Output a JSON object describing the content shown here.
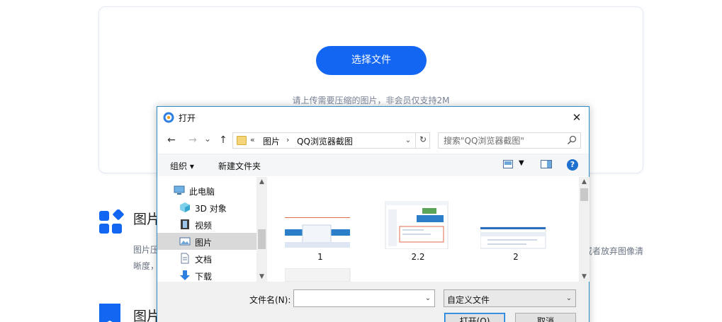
{
  "page": {
    "select_file_label": "选择文件",
    "upload_hint": "请上传需要压缩的图片，非会员仅支持2M",
    "feature1": {
      "title": "图片",
      "desc_line1": "图片压",
      "desc_line2": "晰度，",
      "desc_right": "或者放弃图像清"
    },
    "feature2": {
      "title": "图片"
    }
  },
  "dialog": {
    "title": "打开",
    "close_label": "✕",
    "nav": {
      "back": "←",
      "forward": "→",
      "recent": "⌄",
      "up": "↑"
    },
    "address": {
      "chevron": "«",
      "segments": [
        "图片",
        "QQ浏览器截图"
      ],
      "separator": "›"
    },
    "search_placeholder": "搜索\"QQ浏览器截图\"",
    "toolbar": {
      "organize": "组织 ▾",
      "new_folder": "新建文件夹",
      "help": "?"
    },
    "nav_pane": {
      "items": [
        {
          "label": "此电脑",
          "icon": "computer-icon"
        },
        {
          "label": "3D 对象",
          "icon": "3d-objects-icon"
        },
        {
          "label": "视频",
          "icon": "video-icon"
        },
        {
          "label": "图片",
          "icon": "pictures-icon",
          "selected": true
        },
        {
          "label": "文档",
          "icon": "documents-icon"
        },
        {
          "label": "下载",
          "icon": "downloads-icon"
        }
      ]
    },
    "files": [
      {
        "name": "1"
      },
      {
        "name": "2.2"
      },
      {
        "name": "2"
      },
      {
        "name": ""
      }
    ],
    "footer": {
      "filename_label": "文件名(N):",
      "filename_value": "",
      "filetype_value": "自定义文件",
      "open_label": "打开(O)",
      "cancel_label": "取消"
    }
  },
  "colors": {
    "accent": "#1266f1",
    "dialog_border": "#2b8ec9",
    "selected_bg": "#d9d9d9"
  }
}
